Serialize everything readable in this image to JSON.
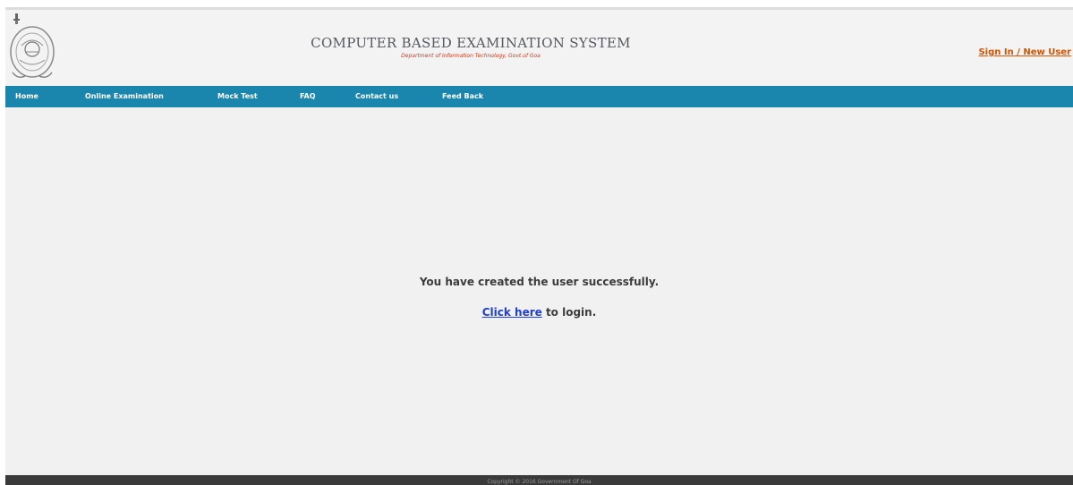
{
  "header": {
    "title": "COMPUTER BASED EXAMINATION SYSTEM",
    "subtitle": "Department of Information Technology, Govt.of Goa",
    "signin_label": "Sign In / New User"
  },
  "nav": {
    "items": [
      {
        "label": "Home"
      },
      {
        "label": "Online Examination"
      },
      {
        "label": "Mock Test"
      },
      {
        "label": "FAQ"
      },
      {
        "label": "Contact us"
      },
      {
        "label": "Feed Back"
      }
    ]
  },
  "main": {
    "message": "You have created the user successfully.",
    "link_label": "Click here",
    "after_link": " to login."
  },
  "footer": {
    "text": "Copyright © 2016 Government Of Goa"
  }
}
